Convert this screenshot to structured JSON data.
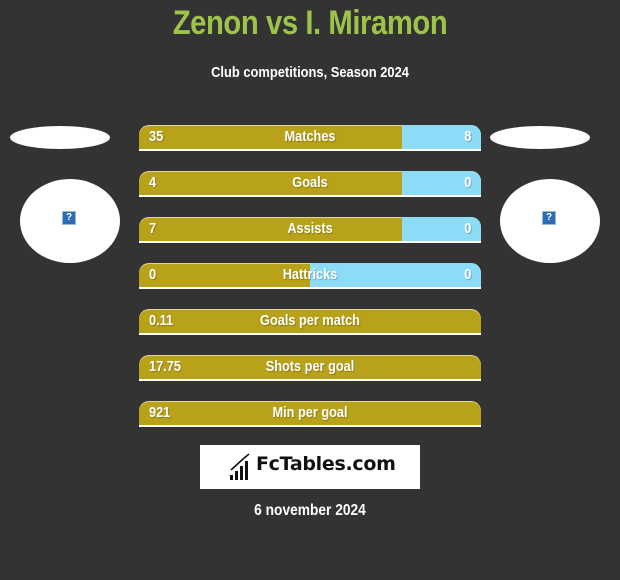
{
  "header": {
    "title": "Zenon vs I. Miramon",
    "subtitle": "Club competitions, Season 2024"
  },
  "players": {
    "left": {
      "name": "Zenon",
      "avatar_icon": "missing-image-icon"
    },
    "right": {
      "name": "I. Miramon",
      "avatar_icon": "missing-image-icon"
    }
  },
  "colors": {
    "background": "#333333",
    "title": "#9dc34a",
    "left_bar": "#b8a21a",
    "right_bar": "#8ddcf7"
  },
  "stats": [
    {
      "label": "Matches",
      "left": "35",
      "right": "8",
      "right_share": 0.23
    },
    {
      "label": "Goals",
      "left": "4",
      "right": "0",
      "right_share": 0.23
    },
    {
      "label": "Assists",
      "left": "7",
      "right": "0",
      "right_share": 0.23
    },
    {
      "label": "Hattricks",
      "left": "0",
      "right": "0",
      "right_share": 0.5
    },
    {
      "label": "Goals per match",
      "left": "0.11",
      "right": "",
      "right_share": 0
    },
    {
      "label": "Shots per goal",
      "left": "17.75",
      "right": "",
      "right_share": 0
    },
    {
      "label": "Min per goal",
      "left": "921",
      "right": "",
      "right_share": 0
    }
  ],
  "footer": {
    "logo_text": "FcTables.com",
    "date": "6 november 2024"
  }
}
